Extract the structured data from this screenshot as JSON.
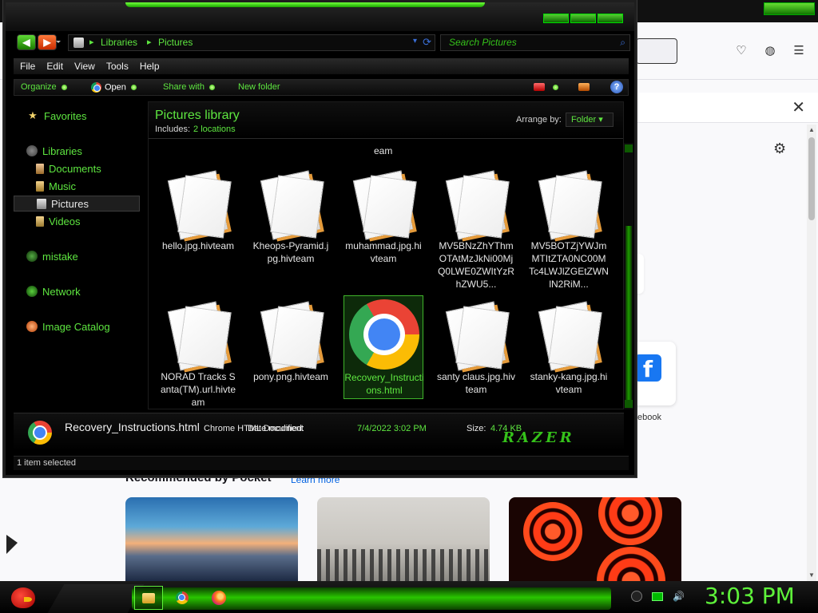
{
  "browser": {
    "notification_close": "✕",
    "gear": "⚙",
    "facebook_tile_letter": "f",
    "facebook_label": "ebook",
    "pocket_title": "Recommended by Pocket",
    "pocket_link": "Learn more",
    "toolbar_icons": [
      "pocket-icon",
      "account-icon",
      "menu-icon"
    ],
    "toolbar_icon_glyphs": [
      "♡",
      "◍",
      "☰"
    ]
  },
  "explorer": {
    "nav": {
      "back": "◀",
      "forward": "▶",
      "breadcrumb": [
        "Libraries",
        "Pictures"
      ],
      "search_placeholder": "Search Pictures",
      "search_icon": "⌕",
      "refresh_icon": "⟳",
      "dropdown_icon": "▾"
    },
    "menu": [
      "File",
      "Edit",
      "View",
      "Tools",
      "Help"
    ],
    "commands": {
      "organize": "Organize",
      "open": "Open",
      "share": "Share with",
      "new_folder": "New folder",
      "help": "?"
    },
    "sidebar": {
      "favorites": "Favorites",
      "libraries": "Libraries",
      "documents": "Documents",
      "music": "Music",
      "pictures": "Pictures",
      "videos": "Videos",
      "home": "mistake",
      "network": "Network",
      "catalog": "Image Catalog"
    },
    "library": {
      "title": "Pictures library",
      "includes_label": "Includes:",
      "includes_value": "2 locations",
      "arrange_label": "Arrange by:",
      "arrange_value": "Folder ▾",
      "partial_label": "eam"
    },
    "files": [
      {
        "name": "hello.jpg.hivteam",
        "type": "doc"
      },
      {
        "name": "Kheops-Pyramid.jpg.hivteam",
        "type": "doc"
      },
      {
        "name": "muhammad.jpg.hivteam",
        "type": "doc"
      },
      {
        "name": "MV5BNzZhYThmOTAtMzJkNi00MjQ0LWE0ZWItYzRhZWU5...",
        "type": "doc"
      },
      {
        "name": "MV5BOTZjYWJmMTItZTA0NC00MTc4LWJlZGEtZWNlN2RiM...",
        "type": "doc"
      },
      {
        "name": "NORAD Tracks Santa(TM).url.hivteam",
        "type": "doc"
      },
      {
        "name": "pony.png.hivteam",
        "type": "doc"
      },
      {
        "name": "Recovery_Instructions.html",
        "type": "chrome"
      },
      {
        "name": "santy claus.jpg.hivteam",
        "type": "doc"
      },
      {
        "name": "stanky-kang.jpg.hivteam",
        "type": "doc"
      }
    ],
    "details": {
      "file_name": "Recovery_Instructions.html",
      "file_type": "Chrome HTML Document",
      "date_label": "Date modified:",
      "date_value": "7/4/2022 3:02 PM",
      "size_label": "Size:",
      "size_value": "4.74 KB",
      "brand": "RAZER"
    },
    "status": "1 item selected"
  },
  "taskbar": {
    "clock": "3:03 PM",
    "pinned": [
      "explorer-button",
      "chrome-button",
      "firefox-button"
    ],
    "volume_icon": "🔊"
  },
  "colors": {
    "accent_green": "#5ee640",
    "window_bg": "#000000",
    "browser_bg": "#f9f9fb"
  }
}
